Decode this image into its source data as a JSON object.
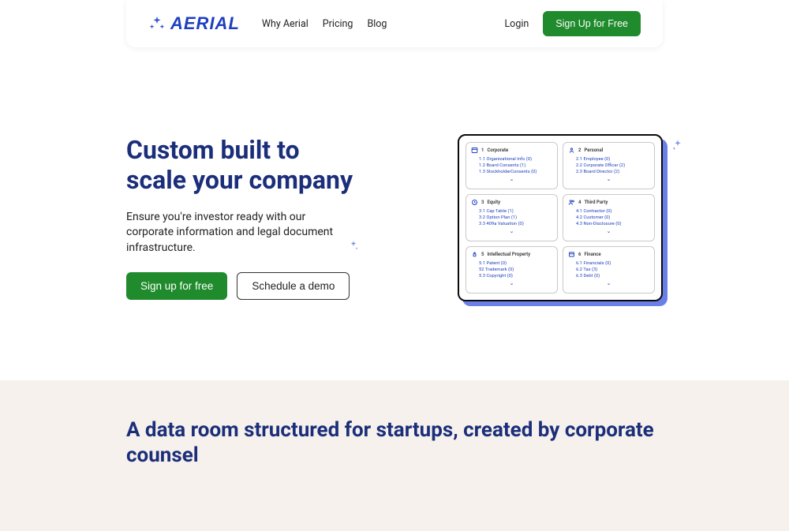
{
  "brand": "AERIAL",
  "nav": {
    "links": [
      "Why Aerial",
      "Pricing",
      "Blog"
    ],
    "login": "Login",
    "signup": "Sign Up for Free"
  },
  "hero": {
    "title": "Custom built to scale your company",
    "subtitle": "Ensure you're investor ready with our corporate information and legal document infrastructure.",
    "cta_primary": "Sign up for free",
    "cta_secondary": "Schedule a demo"
  },
  "dataroom": {
    "cells": [
      {
        "num": "1",
        "title": "Corporate",
        "items": [
          "1.1  Organizational Info (0)",
          "1.2  Board Consents (1)",
          "1.3  StockholderConsents (0)"
        ]
      },
      {
        "num": "2",
        "title": "Personal",
        "items": [
          "2.1  Employee (0)",
          "2.2  Corporate Officer (2)",
          "2.3  Board Director (2)"
        ]
      },
      {
        "num": "3",
        "title": "Equity",
        "items": [
          "3.1  Cap Table (1)",
          "3.2  Option Plan (1)",
          "3.3  409a Valuation (0)"
        ]
      },
      {
        "num": "4",
        "title": "Third Party",
        "items": [
          "4.1  Contractor (0)",
          "4.2  Customer (0)",
          "4.3  Non-Disclosure (0)"
        ]
      },
      {
        "num": "5",
        "title": "Intellectual Property",
        "items": [
          "5.1  Patent (0)",
          "52  Trademark (0)",
          "5.3  Copyright (0)"
        ]
      },
      {
        "num": "6",
        "title": "Finance",
        "items": [
          "6.1  Financials (0)",
          "6.2  Tax (3)",
          "6.3  Debt (0)"
        ]
      }
    ]
  },
  "section2": {
    "title": "A data room structured for startups, created by corporate counsel"
  }
}
